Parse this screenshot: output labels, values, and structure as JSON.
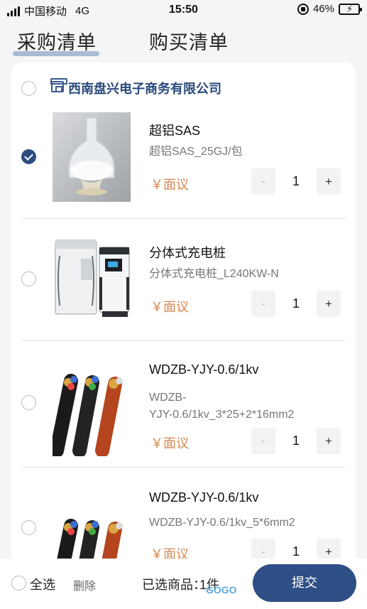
{
  "status_bar": {
    "carrier": "中国移动",
    "network": "4G",
    "time": "15:50",
    "battery": "46%",
    "battery_level": 0.46
  },
  "tabs": [
    {
      "label": "采购清单",
      "active": true
    },
    {
      "label": "购买清单",
      "active": false
    }
  ],
  "store": {
    "name": "西南盘兴电子商务有限公司",
    "selected": false,
    "icon": "store-icon"
  },
  "items": [
    {
      "title": "超铝SAS",
      "spec": "超铝SAS_25GJ/包",
      "price": "￥面议",
      "qty": "1",
      "selected": true,
      "image": "powder-flask-image"
    },
    {
      "title": "分体式充电桩",
      "spec": "分体式充电桩_L240KW-N",
      "price": "￥面议",
      "qty": "1",
      "selected": false,
      "image": "charging-pile-image"
    },
    {
      "title": "WDZB-YJY-0.6/1kv",
      "spec": "WDZB-YJY-0.6/1kv_3*25+2*16mm2",
      "spec_lines": [
        "WDZB-",
        "YJY-0.6/1kv_3*25+2*16mm2"
      ],
      "price": "￥面议",
      "qty": "1",
      "selected": false,
      "image": "cable-image"
    },
    {
      "title": "WDZB-YJY-0.6/1kv",
      "spec": "WDZB-YJY-0.6/1kv_5*6mm2",
      "price": "￥面议",
      "qty": "1",
      "selected": false,
      "image": "cable-image"
    }
  ],
  "stepper": {
    "minus": "-",
    "plus": "+"
  },
  "bottom_bar": {
    "select_all": "全选",
    "delete": "删除",
    "selected_label": "已选商品：",
    "selected_count": "1件",
    "submit": "提交"
  },
  "watermark": "GOGO手游网",
  "colors": {
    "accent": "#2e4f86",
    "price": "#d7864d",
    "store_name": "#2a4a7d"
  }
}
